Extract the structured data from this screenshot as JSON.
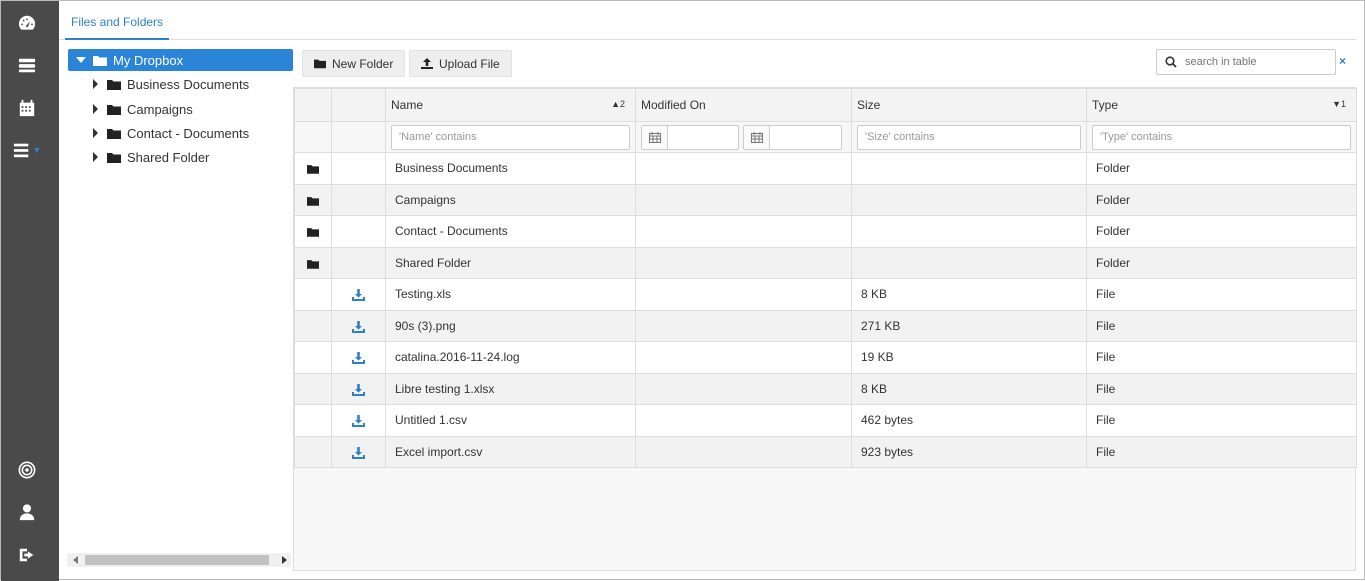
{
  "sidebar": {
    "icons": [
      "dashboard-icon",
      "server-icon",
      "calendar-icon",
      "menu-icon",
      "target-icon",
      "user-icon",
      "logout-icon"
    ]
  },
  "tab": {
    "label": "Files and Folders"
  },
  "tree": {
    "root": "My Dropbox",
    "children": [
      "Business Documents",
      "Campaigns",
      "Contact - Documents",
      "Shared Folder"
    ]
  },
  "toolbar": {
    "new_folder": "New Folder",
    "upload_file": "Upload File",
    "search_placeholder": "search in table",
    "clear": "×"
  },
  "table": {
    "headers": {
      "name": "Name",
      "modified": "Modified On",
      "size": "Size",
      "type": "Type"
    },
    "sort": {
      "name": "2",
      "type": "1"
    },
    "filters": {
      "name": "'Name' contains",
      "size": "'Size' contains",
      "type": "'Type' contains"
    },
    "rows": [
      {
        "kind": "folder",
        "name": "Business Documents",
        "modified": "",
        "size": "",
        "type": "Folder"
      },
      {
        "kind": "folder",
        "name": "Campaigns",
        "modified": "",
        "size": "",
        "type": "Folder"
      },
      {
        "kind": "folder",
        "name": "Contact - Documents",
        "modified": "",
        "size": "",
        "type": "Folder"
      },
      {
        "kind": "folder",
        "name": "Shared Folder",
        "modified": "",
        "size": "",
        "type": "Folder"
      },
      {
        "kind": "file",
        "name": "Testing.xls",
        "modified": "",
        "size": "8 KB",
        "type": "File"
      },
      {
        "kind": "file",
        "name": "90s (3).png",
        "modified": "",
        "size": "271 KB",
        "type": "File"
      },
      {
        "kind": "file",
        "name": "catalina.2016-11-24.log",
        "modified": "",
        "size": "19 KB",
        "type": "File"
      },
      {
        "kind": "file",
        "name": "Libre testing 1.xlsx",
        "modified": "",
        "size": "8 KB",
        "type": "File"
      },
      {
        "kind": "file",
        "name": "Untitled 1.csv",
        "modified": "",
        "size": "462 bytes",
        "type": "File"
      },
      {
        "kind": "file",
        "name": "Excel import.csv",
        "modified": "",
        "size": "923 bytes",
        "type": "File"
      }
    ]
  },
  "colors": {
    "accent": "#2a85d8",
    "sidebar": "#4a4a4a",
    "download": "#2e80c8"
  }
}
